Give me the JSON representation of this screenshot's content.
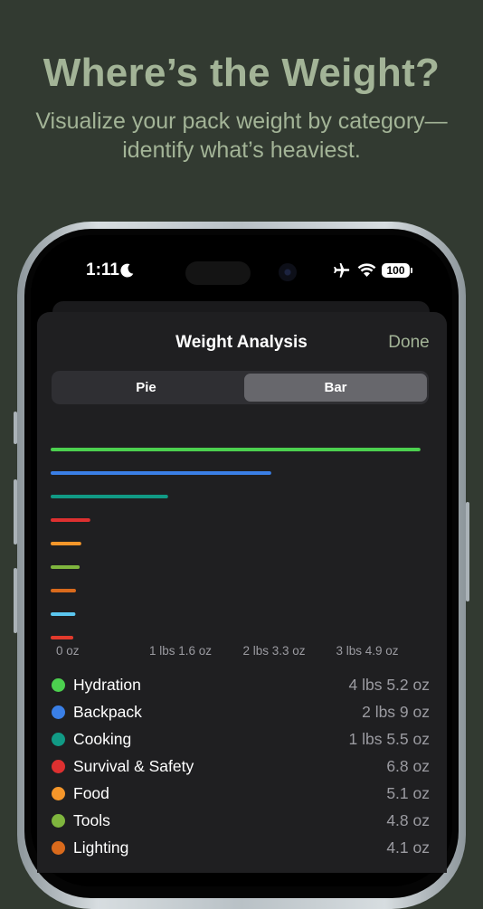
{
  "promo": {
    "headline": "Where’s the Weight?",
    "subline_1": "Visualize your pack weight by category—",
    "subline_2": "identify what’s heaviest."
  },
  "status_bar": {
    "time": "1:11",
    "battery": "100",
    "icons": [
      "moon-icon",
      "airplane-icon",
      "wifi-icon",
      "battery-icon"
    ]
  },
  "sheet": {
    "title": "Weight Analysis",
    "done_label": "Done"
  },
  "segmented": {
    "options": [
      "Pie",
      "Bar"
    ],
    "selected": "Bar"
  },
  "colors": {
    "accent": "#a3b497",
    "background": "#323a31"
  },
  "chart_data": {
    "type": "bar",
    "orientation": "horizontal",
    "categories": [
      "Hydration",
      "Backpack",
      "Cooking",
      "Survival & Safety",
      "Food",
      "Tools",
      "Lighting",
      "",
      ""
    ],
    "values_oz": [
      69.2,
      41,
      21.5,
      6.8,
      5.1,
      4.8,
      4.1,
      4.0,
      3.6
    ],
    "colors": [
      "#4cd04f",
      "#3a7fe6",
      "#119a85",
      "#dd3030",
      "#f5962a",
      "#7fb53e",
      "#d96a1c",
      "#5bc6ef",
      "#e23a2c"
    ],
    "x_ticks": [
      "0 oz",
      "1 lbs 1.6 oz",
      "2 lbs 3.3 oz",
      "3 lbs 4.9 oz"
    ],
    "x_tick_values": [
      0,
      17.6,
      35.3,
      52.9
    ],
    "xlim": [
      0,
      70
    ]
  },
  "legend": [
    {
      "name": "Hydration",
      "value": "4 lbs 5.2 oz",
      "color": "#4cd04f"
    },
    {
      "name": "Backpack",
      "value": "2 lbs 9 oz",
      "color": "#3a7fe6"
    },
    {
      "name": "Cooking",
      "value": "1 lbs 5.5 oz",
      "color": "#119a85"
    },
    {
      "name": "Survival & Safety",
      "value": "6.8 oz",
      "color": "#dd3030"
    },
    {
      "name": "Food",
      "value": "5.1 oz",
      "color": "#f5962a"
    },
    {
      "name": "Tools",
      "value": "4.8 oz",
      "color": "#7fb53e"
    },
    {
      "name": "Lighting",
      "value": "4.1 oz",
      "color": "#d96a1c"
    }
  ]
}
